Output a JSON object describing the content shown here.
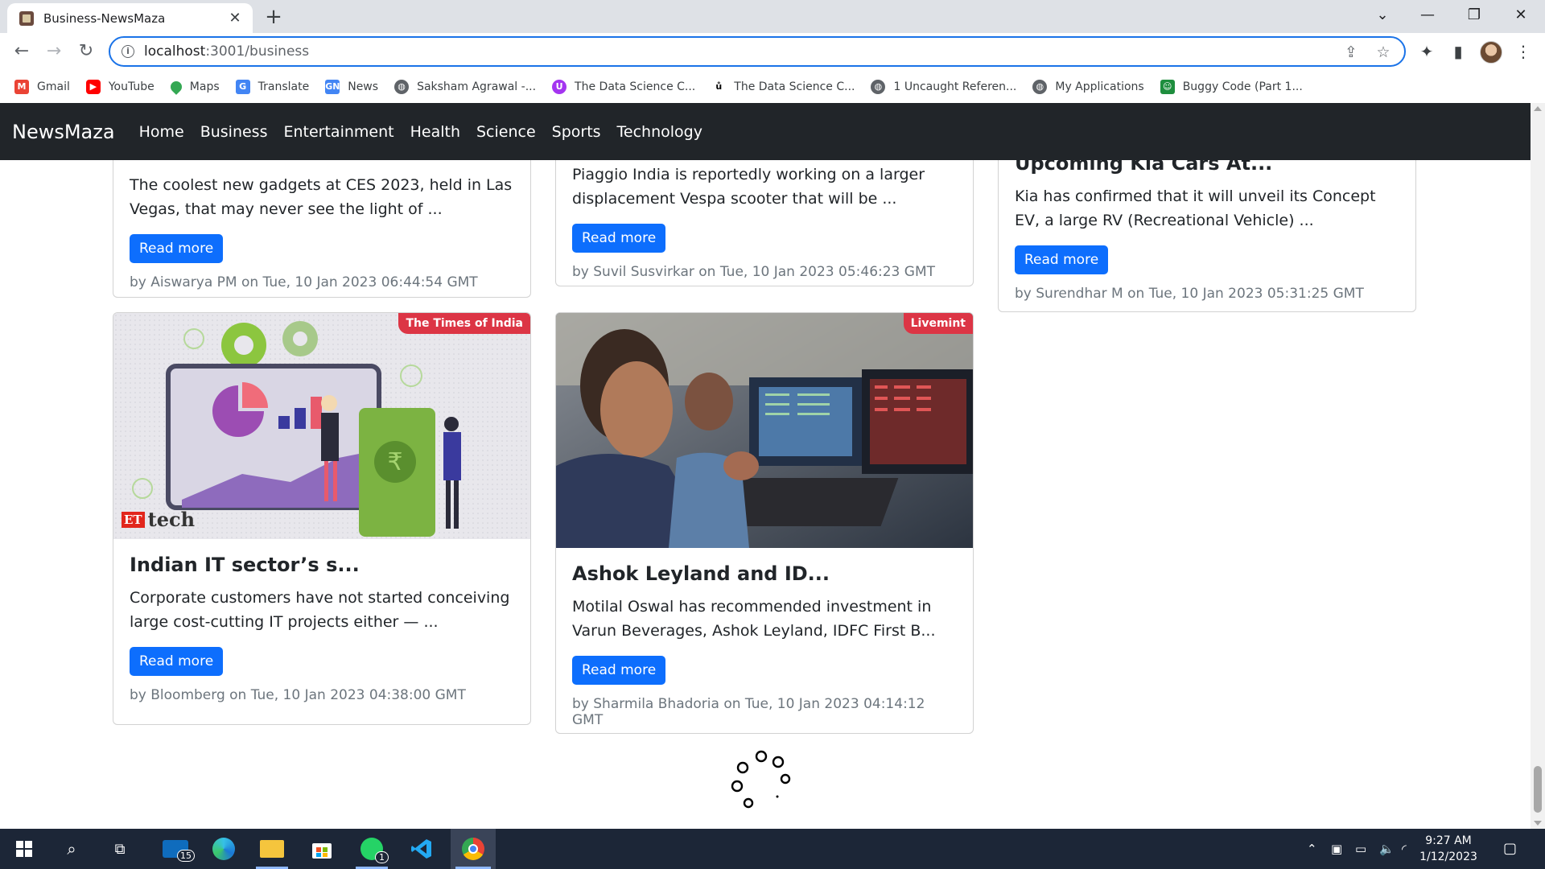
{
  "browser": {
    "tab_title": "Business-NewsMaza",
    "url_host": "localhost",
    "url_path": ":3001/business",
    "bookmarks": [
      {
        "label": "Gmail",
        "icon": "gmail-icon",
        "color": "#ea4335"
      },
      {
        "label": "YouTube",
        "icon": "youtube-icon",
        "color": "#ff0000"
      },
      {
        "label": "Maps",
        "icon": "maps-icon",
        "color": "#34a853"
      },
      {
        "label": "Translate",
        "icon": "translate-icon",
        "color": "#4285f4"
      },
      {
        "label": "News",
        "icon": "news-icon",
        "color": "#4285f4"
      },
      {
        "label": "Saksham Agrawal -...",
        "icon": "globe-icon",
        "color": "#5f6368"
      },
      {
        "label": "The Data Science C...",
        "icon": "udemy-icon",
        "color": "#a435f0"
      },
      {
        "label": "The Data Science C...",
        "icon": "udemy-u-icon",
        "color": "#000000"
      },
      {
        "label": "1 Uncaught Referen...",
        "icon": "globe-icon",
        "color": "#5f6368"
      },
      {
        "label": "My Applications",
        "icon": "globe-icon",
        "color": "#5f6368"
      },
      {
        "label": "Buggy Code (Part 1...",
        "icon": "buggy-icon",
        "color": "#1e8e3e"
      }
    ]
  },
  "navbar": {
    "brand": "NewsMaza",
    "links": [
      "Home",
      "Business",
      "Entertainment",
      "Health",
      "Science",
      "Sports",
      "Technology"
    ],
    "background": "#212529"
  },
  "articles": [
    {
      "title": "",
      "description": "The coolest new gadgets at CES 2023, held in Las Vegas, that may never see the light of ...",
      "button": "Read more",
      "meta": "by Aiswarya PM on Tue, 10 Jan 2023 06:44:54 GMT"
    },
    {
      "title": "",
      "description": "Piaggio India is reportedly working on a larger displacement Vespa scooter that will be ...",
      "button": "Read more",
      "meta": "by Suvil Susvirkar on Tue, 10 Jan 2023 05:46:23 GMT"
    },
    {
      "title": "Upcoming Kia Cars At...",
      "description": "Kia has confirmed that it will unveil its Concept EV, a large RV (Recreational Vehicle) ...",
      "button": "Read more",
      "meta": "by Surendhar M on Tue, 10 Jan 2023 05:31:25 GMT"
    },
    {
      "source": "The Times of India",
      "image_caption": "ET tech",
      "title": "Indian IT sector’s s...",
      "description": "Corporate customers have not started conceiving large cost-cutting IT projects either — ...",
      "button": "Read more",
      "meta": "by Bloomberg on Tue, 10 Jan 2023 04:38:00 GMT"
    },
    {
      "source": "Livemint",
      "title": "Ashok Leyland and ID...",
      "description": "Motilal Oswal has recommended investment in Varun Beverages, Ashok Leyland, IDFC First B...",
      "button": "Read more",
      "meta": "by Sharmila Bhadoria on Tue, 10 Jan 2023 04:14:12 GMT"
    }
  ],
  "colors": {
    "primary_button": "#0d6efd",
    "badge": "#dc3545",
    "meta_text": "#6c757d"
  },
  "taskbar": {
    "mail_badge": "15",
    "whatsapp_badge": "1",
    "time": "9:27 AM",
    "date": "1/12/2023"
  }
}
